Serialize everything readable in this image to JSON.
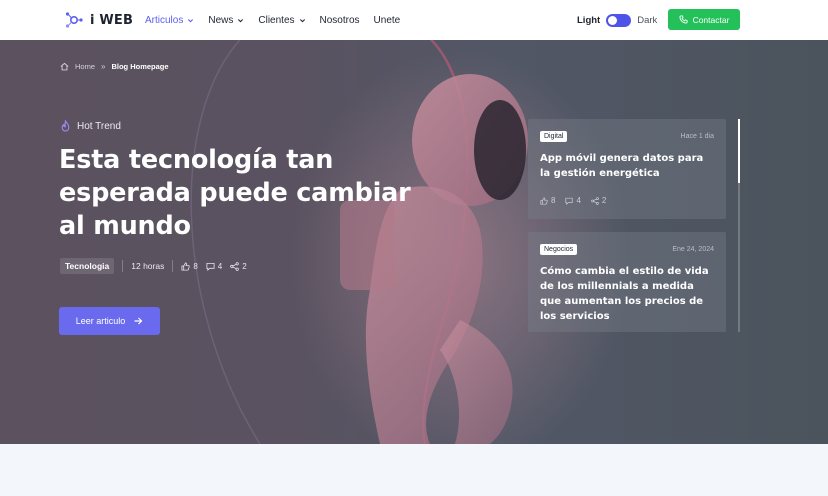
{
  "brand": {
    "name": "i WEB"
  },
  "nav": {
    "items": [
      {
        "label": "Articulos",
        "dropdown": true,
        "active": true
      },
      {
        "label": "News",
        "dropdown": true,
        "active": false
      },
      {
        "label": "Clientes",
        "dropdown": true,
        "active": false
      },
      {
        "label": "Nosotros",
        "dropdown": false,
        "active": false
      },
      {
        "label": "Unete",
        "dropdown": false,
        "active": false
      }
    ],
    "theme": {
      "light": "Light",
      "dark": "Dark",
      "mode": "dark"
    },
    "contact_label": "Contactar"
  },
  "hero": {
    "breadcrumb": {
      "home": "Home",
      "separator": "»",
      "current": "Blog Homepage"
    },
    "trend": "Hot Trend",
    "title": "Esta tecnología tan esperada puede cambiar al mundo",
    "tag": "Tecnologia",
    "time": "12 horas",
    "likes": "8",
    "comments": "4",
    "shares": "2",
    "cta": "Leer articulo"
  },
  "cards": [
    {
      "badge": "Digital",
      "date": "Hace 1 dia",
      "title": "App móvil genera datos para la gestión energética",
      "likes": "8",
      "comments": "4",
      "shares": "2"
    },
    {
      "badge": "Negocios",
      "date": "Ene 24, 2024",
      "title": "Cómo cambia el estilo de vida de los millennials a medida que aumentan los precios de los servicios"
    }
  ],
  "colors": {
    "accent": "#5b5fef",
    "contact": "#24c05a",
    "cta": "#6a6aef"
  },
  "icons": [
    "logo-icon",
    "chevron-down-icon",
    "phone-icon",
    "home-icon",
    "flame-icon",
    "thumbs-up-icon",
    "comment-icon",
    "share-icon",
    "arrow-right-icon"
  ]
}
